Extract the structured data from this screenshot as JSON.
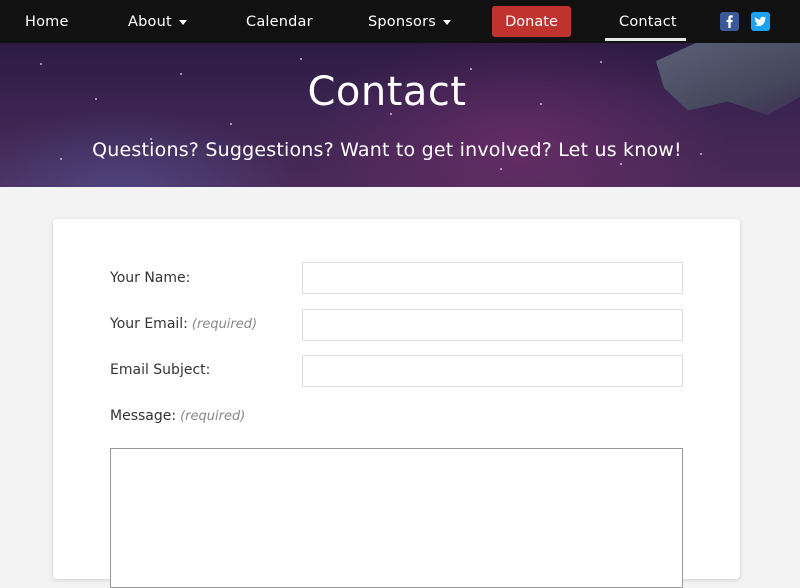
{
  "nav": {
    "home": "Home",
    "about": "About",
    "calendar": "Calendar",
    "sponsors": "Sponsors",
    "donate": "Donate",
    "contact": "Contact",
    "social": [
      "facebook-icon",
      "twitter-icon"
    ],
    "donate_color": "#c0322d"
  },
  "hero": {
    "title": "Contact",
    "subtitle": "Questions? Suggestions? Want to get involved? Let us know!"
  },
  "form": {
    "name_label": "Your Name:",
    "name_value": "",
    "email_label": "Your Email:",
    "email_required": "(required)",
    "email_value": "",
    "subject_label": "Email Subject:",
    "subject_value": "",
    "message_label": "Message:",
    "message_required": "(required)",
    "message_value": ""
  }
}
